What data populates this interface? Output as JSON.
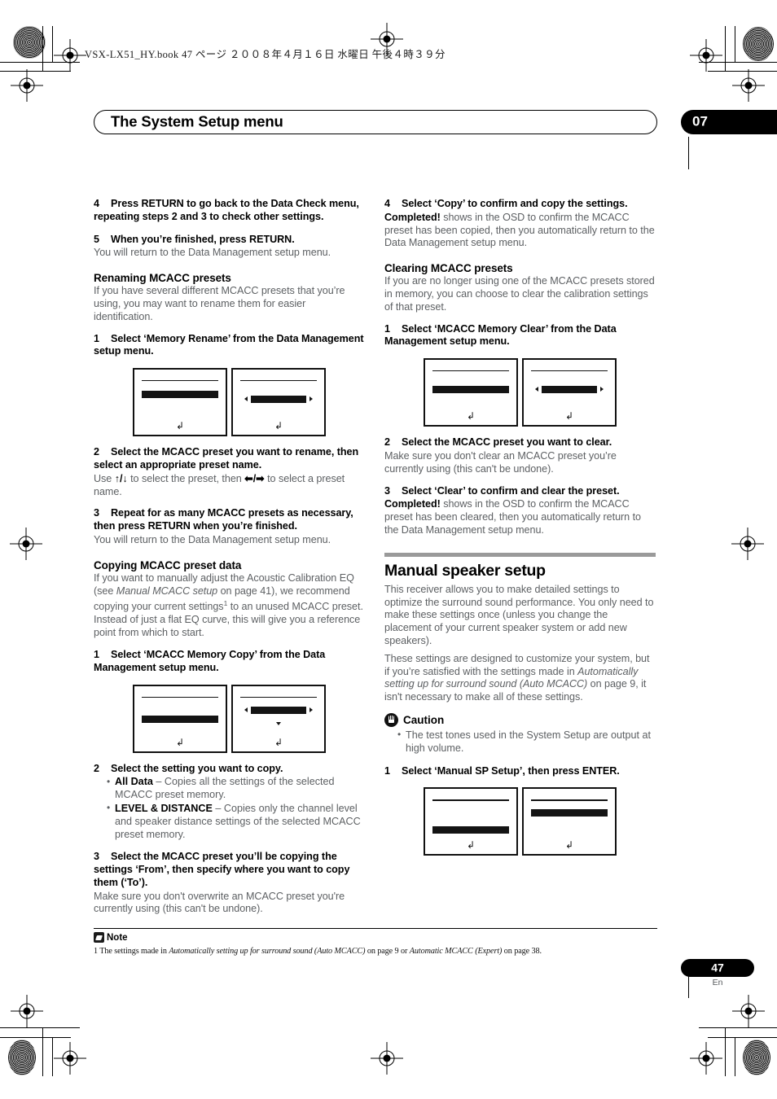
{
  "print_marks": {
    "book_line": "VSX-LX51_HY.book   47 ページ   ２００８年４月１６日   水曜日   午後４時３９分"
  },
  "header": {
    "title": "The System Setup menu",
    "chapter": "07"
  },
  "footer": {
    "page_number": "47",
    "language": "En"
  },
  "note": {
    "label": "Note",
    "text_1": "1 The settings made in ",
    "italic_1": "Automatically setting up for surround sound (Auto MCACC)",
    "text_2": " on page 9 or ",
    "italic_2": "Automatic MCACC (Expert)",
    "text_3": " on page 38."
  },
  "left_column": {
    "step4": {
      "num": "4",
      "text": "Press RETURN to go back to the Data Check menu, repeating steps 2 and 3 to check other settings."
    },
    "step5": {
      "num": "5",
      "text": "When you’re finished, press RETURN.",
      "body": "You will return to the Data Management setup menu."
    },
    "renaming": {
      "heading": "Renaming MCACC presets",
      "body": "If you have several different MCACC presets that you’re using, you may want to rename them for easier identification.",
      "step1_num": "1",
      "step1_text": "Select ‘Memory Rename’ from the Data Management setup menu.",
      "step2_num": "2",
      "step2_text": "Select the MCACC preset you want to rename, then select an appropriate preset name.",
      "step2_body_a": "Use ",
      "step2_body_b": " to select the preset, then ",
      "step2_body_c": " to select a preset name.",
      "step3_num": "3",
      "step3_text": "Repeat for as many MCACC presets as necessary, then press RETURN when you’re finished.",
      "step3_body": "You will return to the Data Management setup menu."
    },
    "copying": {
      "heading": "Copying MCACC preset data",
      "body_a": "If you want to manually adjust the Acoustic Calibration EQ (see ",
      "body_italic": "Manual MCACC setup",
      "body_b": " on page 41), we recommend copying your current settings",
      "body_sup": "1",
      "body_c": " to an unused MCACC preset. Instead of just a flat EQ curve, this will give you a reference point from which to start.",
      "step1_num": "1",
      "step1_text": "Select ‘MCACC Memory Copy’ from the Data Management setup menu.",
      "step2_num": "2",
      "step2_text": "Select the setting you want to copy.",
      "bullet1_label": "All Data",
      "bullet1_text": " – Copies all the settings of the selected MCACC preset memory.",
      "bullet2_label": "LEVEL & DISTANCE",
      "bullet2_text": " – Copies only the channel level and speaker distance settings of the selected MCACC preset memory.",
      "step3_num": "3",
      "step3_text": "Select the MCACC preset you’ll be copying the settings ‘From’, then specify where you want to copy them (‘To’).",
      "step3_body": "Make sure you don't overwrite an MCACC preset you're currently using (this can't be undone)."
    }
  },
  "right_column": {
    "step4": {
      "num": "4",
      "text": "Select ‘Copy’ to confirm and copy the settings.",
      "body_bold": "Completed!",
      "body": " shows in the OSD to confirm the MCACC preset has been copied, then you automatically return to the Data Management setup menu."
    },
    "clearing": {
      "heading": "Clearing MCACC presets",
      "body": "If you are no longer using one of the MCACC presets stored in memory, you can choose to clear the calibration settings of that preset.",
      "step1_num": "1",
      "step1_text": "Select ‘MCACC Memory Clear’ from the Data Management setup menu.",
      "step2_num": "2",
      "step2_text": "Select the MCACC preset you want to clear.",
      "step2_body": "Make sure you don't clear an MCACC preset you’re currently using (this can't be undone).",
      "step3_num": "3",
      "step3_text": "Select ‘Clear’ to confirm and clear the preset.",
      "step3_body_bold": "Completed!",
      "step3_body": " shows in the OSD to confirm the MCACC preset has been cleared, then you automatically return to the Data Management setup menu."
    },
    "manual_speaker": {
      "heading": "Manual speaker setup",
      "para1": "This receiver allows you to make detailed settings to optimize the surround sound performance. You only need to make these settings once (unless you change the placement of your current speaker system or add new speakers).",
      "para2_a": "These settings are designed to customize your system, but if you’re satisfied with the settings made in ",
      "para2_italic": "Automatically setting up for surround sound (Auto MCACC)",
      "para2_b": " on page 9, it isn't necessary to make all of these settings.",
      "caution_label": "Caution",
      "caution_bullet": "The test tones used in the System Setup are output at high volume.",
      "step1_num": "1",
      "step1_text": "Select ‘Manual SP Setup’, then press ENTER."
    }
  },
  "icons": {
    "up_arrow": "↑",
    "down_arrow": "↓",
    "left_arrow": "➡",
    "right_arrow": "⬅",
    "return_arrow": "↰",
    "slash": "/"
  }
}
